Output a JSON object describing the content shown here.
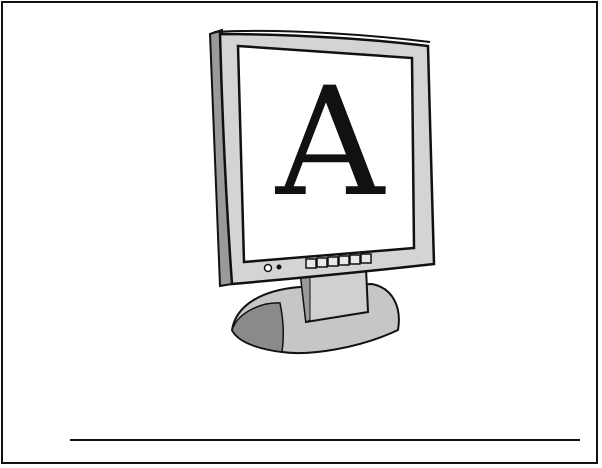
{
  "screen": {
    "letter": "A"
  },
  "colors": {
    "ink": "#111111",
    "bezel": "#d4d4d4",
    "bezel_shadow": "#9a9a9a",
    "stand": "#c6c6c6",
    "stand_dark": "#8a8a8a",
    "screen": "#ffffff"
  }
}
